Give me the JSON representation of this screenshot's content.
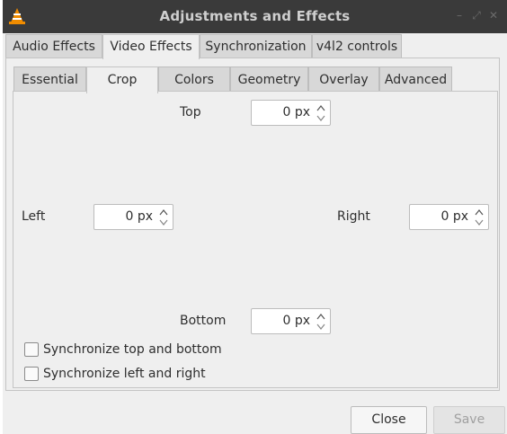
{
  "window": {
    "title": "Adjustments and Effects",
    "controls": [
      "minimize-icon",
      "restore-icon",
      "close-icon"
    ]
  },
  "main_tabs": [
    {
      "label": "Audio Effects",
      "active": false
    },
    {
      "label": "Video Effects",
      "active": true
    },
    {
      "label": "Synchronization",
      "active": false
    },
    {
      "label": "v4l2 controls",
      "active": false
    }
  ],
  "sub_tabs": [
    {
      "label": "Essential",
      "active": false
    },
    {
      "label": "Crop",
      "active": true
    },
    {
      "label": "Colors",
      "active": false
    },
    {
      "label": "Geometry",
      "active": false
    },
    {
      "label": "Overlay",
      "active": false
    },
    {
      "label": "Advanced",
      "active": false
    }
  ],
  "crop": {
    "top": {
      "label": "Top",
      "value": "0 px"
    },
    "left": {
      "label": "Left",
      "value": "0 px"
    },
    "right": {
      "label": "Right",
      "value": "0 px"
    },
    "bottom": {
      "label": "Bottom",
      "value": "0 px"
    }
  },
  "options": {
    "sync_top_bottom": {
      "label": "Synchronize top and bottom",
      "checked": false
    },
    "sync_left_right": {
      "label": "Synchronize left and right",
      "checked": false
    }
  },
  "buttons": {
    "close": "Close",
    "save": "Save"
  },
  "colors": {
    "titlebar": "#3a3a3a",
    "window_bg": "#efefef",
    "accent_cone": "#f08c00"
  }
}
